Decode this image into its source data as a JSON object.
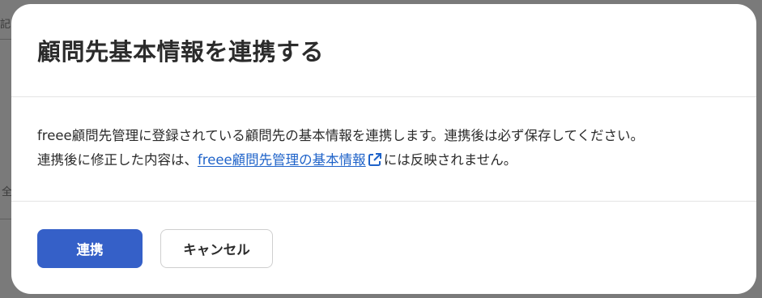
{
  "background": {
    "fragment_top": "記",
    "fragment_mid": "全"
  },
  "dialog": {
    "title": "顧問先基本情報を連携する",
    "body_line1": "freee顧問先管理に登録されている顧問先の基本情報を連携します。連携後は必ず保存してください。",
    "body_line2_prefix": "連携後に修正した内容は、",
    "link_text": "freee顧問先管理の基本情報",
    "body_line2_suffix": "には反映されません。",
    "external_icon": "external-link-icon",
    "primary_button": "連携",
    "secondary_button": "キャンセル"
  },
  "colors": {
    "overlay": "#7a7a7a",
    "primary": "#3560c8",
    "link": "#1f63c9",
    "text": "#2b2b2b"
  }
}
